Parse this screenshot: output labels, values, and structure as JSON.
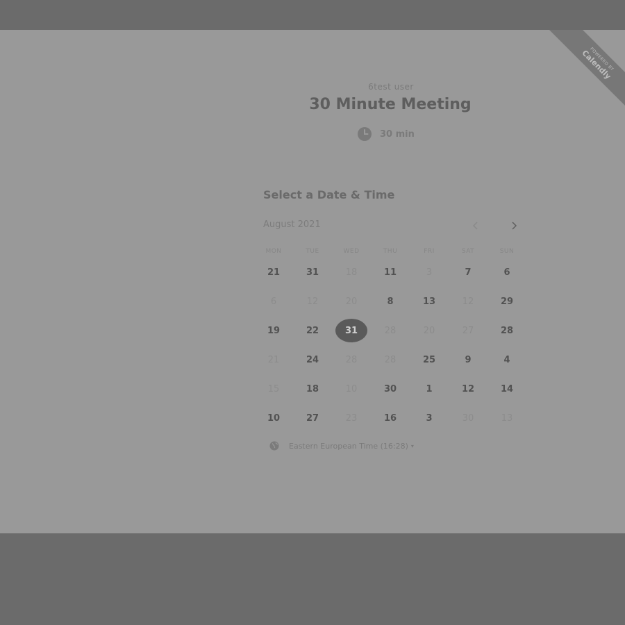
{
  "ribbon": {
    "small": "POWERED BY",
    "big": "Calendly"
  },
  "event": {
    "host": "6test user",
    "title": "30 Minute Meeting",
    "duration": "30 min",
    "duration_icon": "clock-icon"
  },
  "picker": {
    "heading": "Select a Date & Time",
    "month": "August 2021",
    "prev_icon": "chevron-left-icon",
    "next_icon": "chevron-right-icon",
    "weekdays": [
      "MON",
      "TUE",
      "WED",
      "THU",
      "FRI",
      "SAT",
      "SUN"
    ],
    "rows": [
      [
        "21",
        "31",
        "18",
        "11",
        "3",
        "7",
        "6"
      ],
      [
        "6",
        "12",
        "20",
        "8",
        "13",
        "12",
        "29"
      ],
      [
        "19",
        "22",
        "31",
        "28",
        "20",
        "27",
        "28"
      ],
      [
        "21",
        "24",
        "28",
        "28",
        "25",
        "9",
        "4"
      ],
      [
        "15",
        "18",
        "10",
        "30",
        "1",
        "12",
        "14"
      ],
      [
        "10",
        "27",
        "23",
        "16",
        "3",
        "30",
        "13"
      ]
    ],
    "available": [
      [
        true,
        true,
        false,
        true,
        false,
        true,
        true
      ],
      [
        false,
        false,
        false,
        true,
        true,
        false,
        true
      ],
      [
        true,
        true,
        true,
        false,
        false,
        false,
        true
      ],
      [
        false,
        true,
        false,
        false,
        true,
        true,
        true
      ],
      [
        false,
        true,
        false,
        true,
        true,
        true,
        true
      ],
      [
        true,
        true,
        false,
        true,
        true,
        false,
        false
      ]
    ],
    "selected": {
      "row": 2,
      "col": 2
    }
  },
  "timezone": {
    "label": "Eastern European Time (16:28)",
    "icon": "globe-icon",
    "caret": "▾"
  }
}
